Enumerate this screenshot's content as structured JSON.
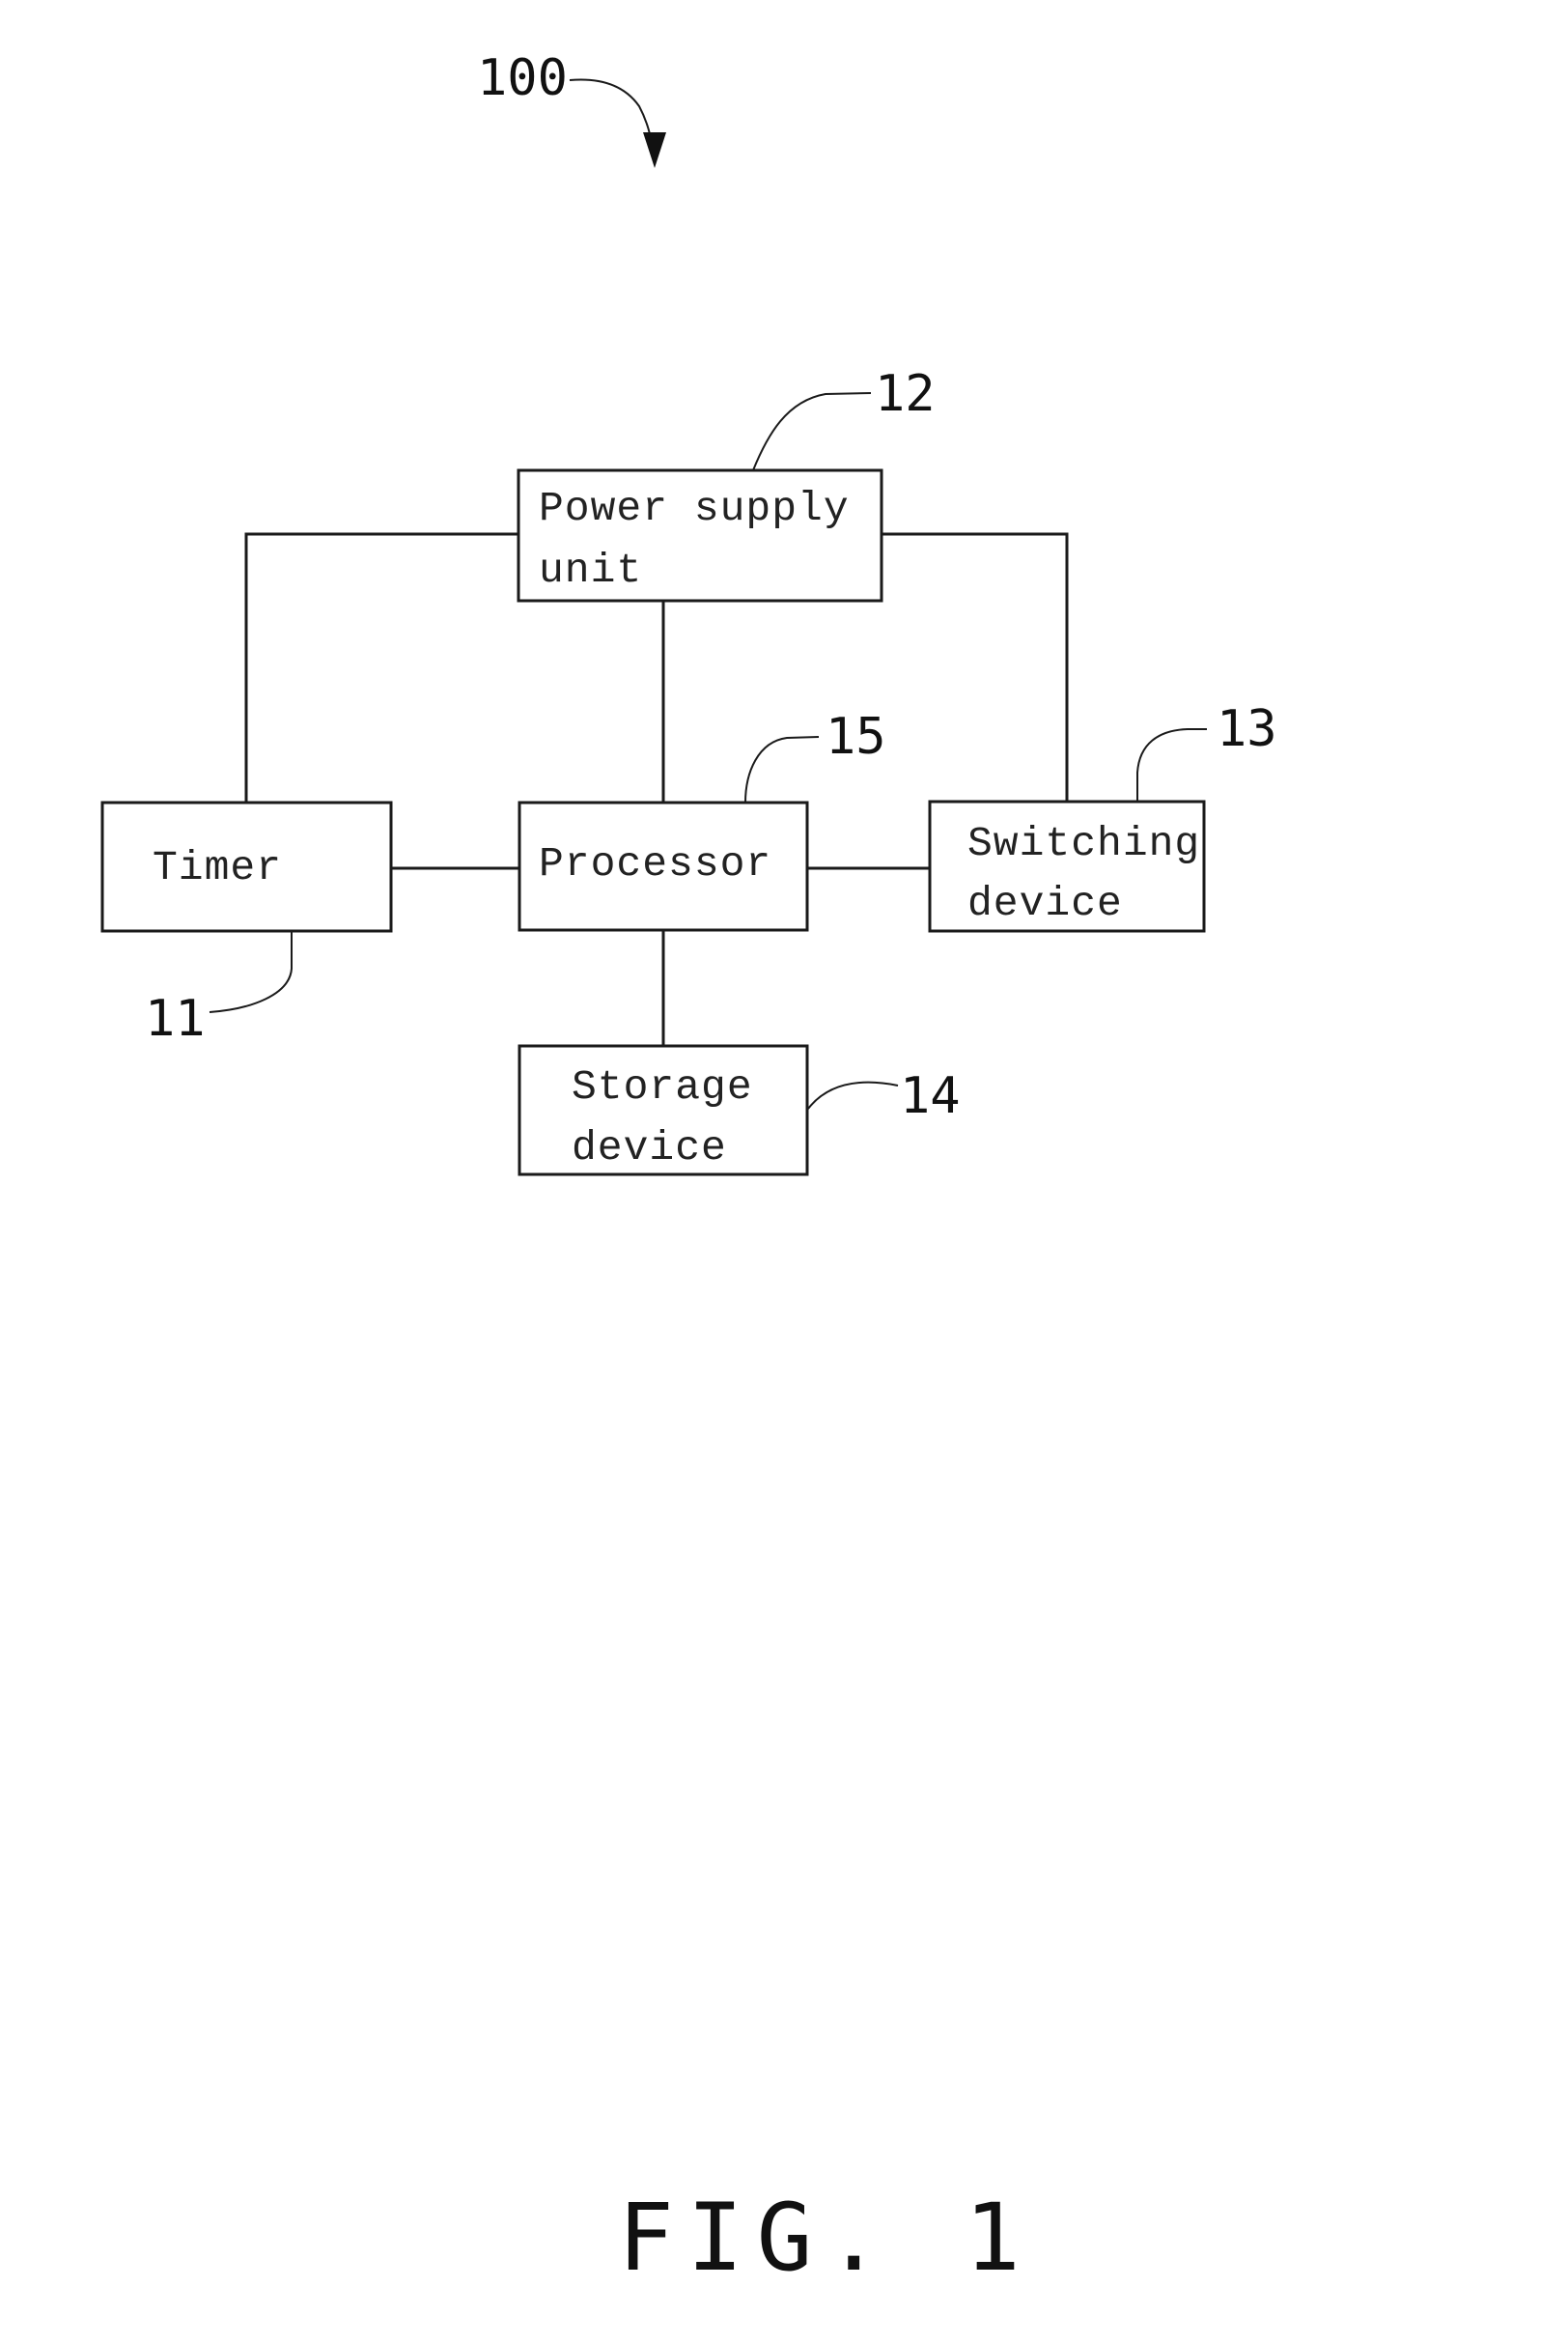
{
  "figure": {
    "caption": "FIG. 1",
    "system_ref": "100"
  },
  "blocks": {
    "power_supply": {
      "ref": "12",
      "lines": [
        "Power supply",
        "unit"
      ]
    },
    "timer": {
      "ref": "11",
      "lines": [
        "Timer"
      ]
    },
    "processor": {
      "ref": "15",
      "lines": [
        "Processor"
      ]
    },
    "switching": {
      "ref": "13",
      "lines": [
        "Switching",
        "device"
      ]
    },
    "storage": {
      "ref": "14",
      "lines": [
        "Storage",
        "device"
      ]
    }
  },
  "connections": [
    {
      "from": "power_supply",
      "to": "timer"
    },
    {
      "from": "power_supply",
      "to": "processor"
    },
    {
      "from": "power_supply",
      "to": "switching"
    },
    {
      "from": "timer",
      "to": "processor"
    },
    {
      "from": "processor",
      "to": "switching"
    },
    {
      "from": "processor",
      "to": "storage"
    }
  ]
}
